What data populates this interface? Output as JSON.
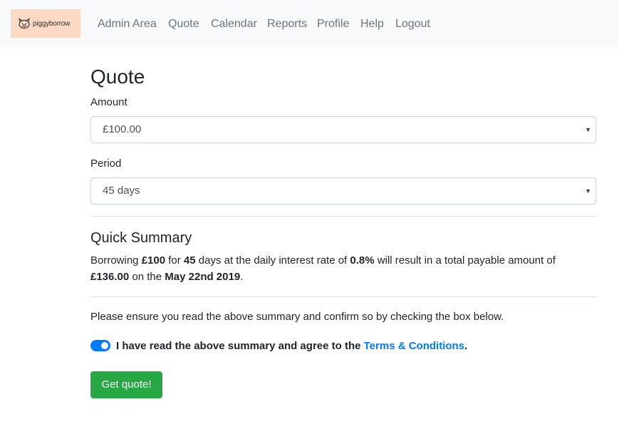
{
  "brand": {
    "name": "piggyborrow",
    "icon": "pig-icon"
  },
  "nav": {
    "items": [
      {
        "label": "Admin Area"
      },
      {
        "label": "Quote"
      },
      {
        "label": "Calendar"
      },
      {
        "label": "Reports"
      },
      {
        "label": "Profile"
      },
      {
        "label": "Help"
      },
      {
        "label": "Logout"
      }
    ]
  },
  "page": {
    "title": "Quote"
  },
  "form": {
    "amount_label": "Amount",
    "amount_value": "£100.00",
    "period_label": "Period",
    "period_value": "45 days"
  },
  "summary": {
    "title": "Quick Summary",
    "t1": "Borrowing ",
    "amount": "£100",
    "t2": " for ",
    "days": "45",
    "t3": " days at the daily interest rate of ",
    "rate": "0.8%",
    "t4": " will result in a total payable amount of ",
    "total": "£136.00",
    "t5": " on the ",
    "date": "May 22nd 2019",
    "t6": "."
  },
  "confirm": {
    "note": "Please ensure you read the above summary and confirm so by checking the box below.",
    "toggle_on": true,
    "agree_text": "I have read the above summary and agree to the ",
    "terms_link": "Terms & Conditions",
    "agree_end": "."
  },
  "actions": {
    "submit_label": "Get quote!"
  },
  "colors": {
    "primary": "#007bff",
    "success": "#28a745",
    "brand_bg": "#fcd9c4",
    "nav_bg": "#f8f9fa"
  }
}
